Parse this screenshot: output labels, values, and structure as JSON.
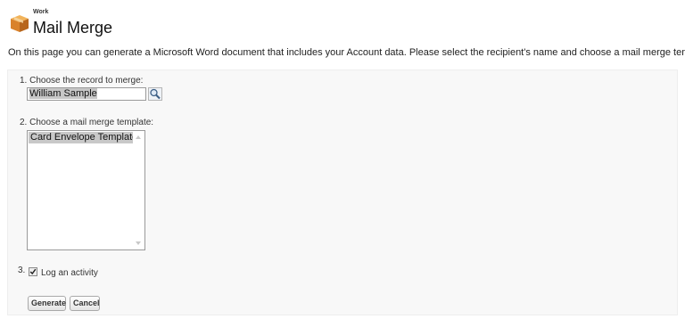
{
  "header": {
    "breadcrumb": "Work",
    "title": "Mail Merge",
    "icon": "box-icon"
  },
  "description": "On this page you can generate a Microsoft Word document that includes your Account data. Please select the recipient's name and choose a mail merge template.",
  "step1": {
    "label": "1. Choose the record to merge:",
    "value": "William Sample",
    "lookup_icon": "magnifier-lookup-icon"
  },
  "step2": {
    "label": "2. Choose a mail merge template:",
    "templates": [
      "Card Envelope Template"
    ],
    "selected": "Card Envelope Template"
  },
  "step3": {
    "number": "3.",
    "checkbox_label": "Log an activity",
    "checked": true
  },
  "buttons": {
    "generate": "Generate",
    "cancel": "Cancel"
  },
  "colors": {
    "selection": "#c8c8c8",
    "panel_bg": "#f8f8f8",
    "logo_orange": "#e8902c"
  }
}
